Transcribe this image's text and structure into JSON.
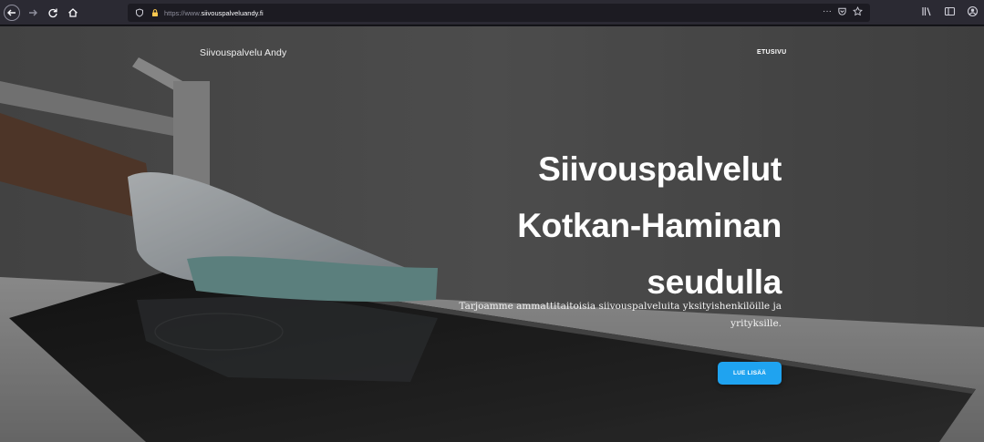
{
  "browser": {
    "url_scheme": "https://www.",
    "url_host": "siivouspalveluandy.fi",
    "url_actions": "···"
  },
  "site": {
    "brand": "Siivouspalvelu Andy",
    "nav": [
      {
        "label": "ETUSIVU"
      }
    ]
  },
  "hero": {
    "title_lines": [
      "Siivouspalvelut",
      "Kotkan-Haminan",
      "seudulla"
    ],
    "subtitle_line1": "Tarjoamme ammattitaitoisia siivouspalveluita yksityishenkilöille ja",
    "subtitle_line2": "yrityksille.",
    "cta_label": "LUE LISÄÄ"
  },
  "colors": {
    "cta": "#1fa3f0",
    "chrome": "#2b2a33",
    "urlbar": "#1c1b22"
  }
}
